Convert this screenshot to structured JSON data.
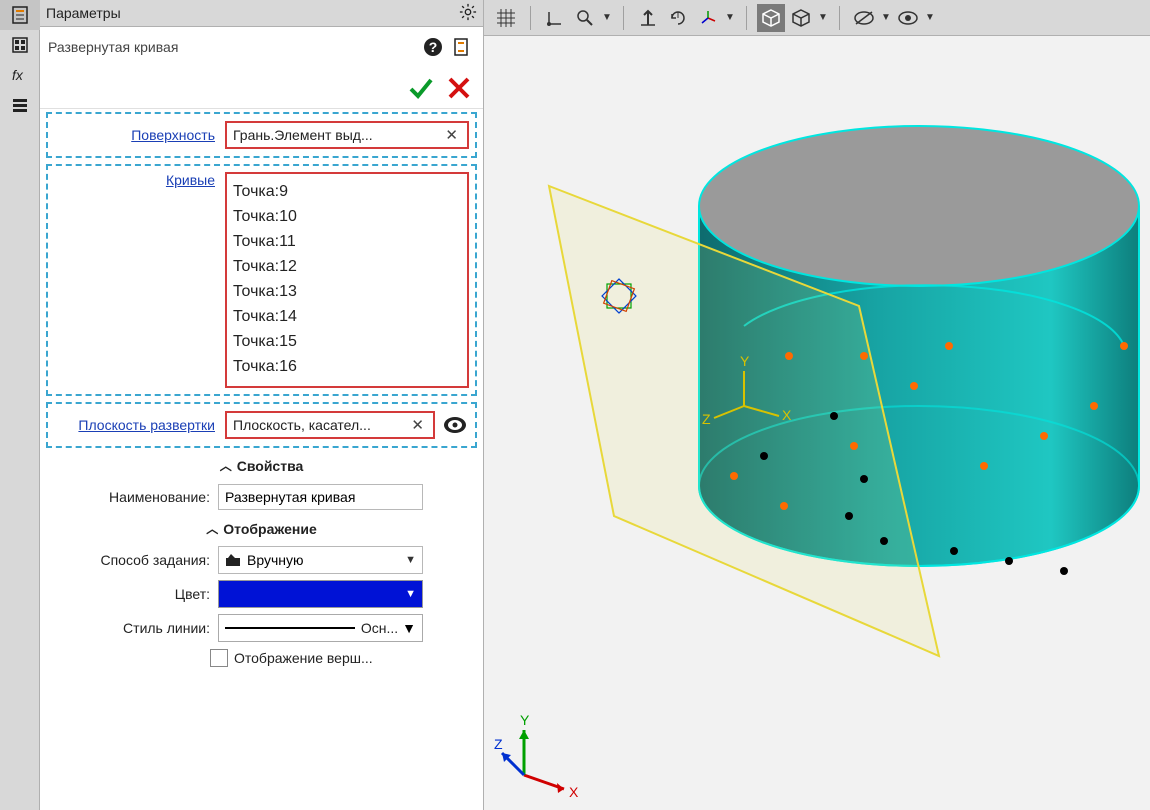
{
  "left_toolbar_icons": [
    "feature-tree-icon",
    "sheet-icon",
    "fx-icon",
    "menu-icon"
  ],
  "panel": {
    "title": "Параметры",
    "subtitle": "Развернутая кривая",
    "labels": {
      "surface": "Поверхность",
      "curves": "Кривые",
      "unfold_plane": "Плоскость развертки"
    },
    "surface_value": "Грань.Элемент выд...",
    "curves_items": [
      "Точка:9",
      "Точка:10",
      "Точка:11",
      "Точка:12",
      "Точка:13",
      "Точка:14",
      "Точка:15",
      "Точка:16"
    ],
    "unfold_plane_value": "Плоскость, касател..."
  },
  "properties": {
    "section_title": "Свойства",
    "name_label": "Наименование:",
    "name_value": "Развернутая кривая"
  },
  "display": {
    "section_title": "Отображение",
    "method_label": "Способ задания:",
    "method_value": "Вручную",
    "color_label": "Цвет:",
    "color_value": "#0012d6",
    "linestyle_label": "Стиль линии:",
    "linestyle_value": "Осн...",
    "show_vertices_label": "Отображение верш..."
  },
  "top_toolbar": {
    "icons": [
      "grid-icon",
      "origin-icon",
      "zoom-icon",
      "axis-up-icon",
      "rotate-view-icon",
      "csys-icon",
      "shade-box-icon",
      "wire-box-icon",
      "hide-icon",
      "show-icon"
    ]
  },
  "axes": {
    "x": "X",
    "y": "Y",
    "z": "Z"
  }
}
